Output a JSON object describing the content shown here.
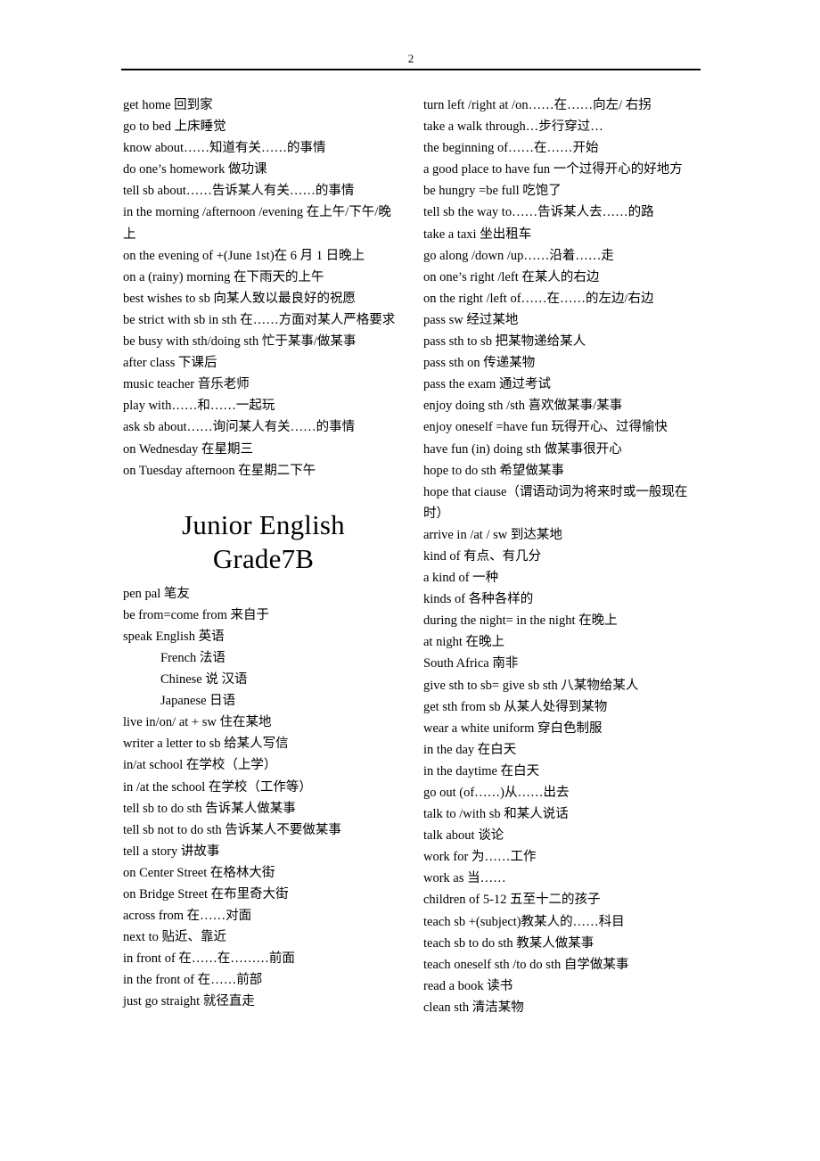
{
  "header": {
    "page_number": "2"
  },
  "title": {
    "line1": "Junior English",
    "line2": "Grade7B"
  },
  "left_column": {
    "entries_before_title": [
      "get home 回到家",
      "go to bed 上床睡觉",
      "know about……知道有关……的事情",
      "do one’s homework 做功课",
      "tell sb about……告诉某人有关……的事情",
      "in the morning /afternoon /evening 在上午/下午/晚上",
      "on the evening of +(June 1st)在 6 月 1 日晚上",
      "on a (rainy) morning 在下雨天的上午",
      "best    wishes to sb 向某人致以最良好的祝愿",
      "be strict with sb in sth 在……方面对某人严格要求",
      "be busy with sth/doing sth 忙于某事/做某事",
      "after class 下课后",
      "music teacher 音乐老师",
      "play with……和……一起玩",
      "ask sb about……询问某人有关……的事情",
      "on Wednesday 在星期三",
      "on Tuesday afternoon 在星期二下午"
    ],
    "entries_after_title": [
      {
        "text": "pen pal 笔友",
        "indent": false
      },
      {
        "text": "be from=come from 来自于",
        "indent": false
      },
      {
        "text": "speak English      英语",
        "indent": false
      },
      {
        "text": "French        法语",
        "indent": true
      },
      {
        "text": "Chinese 说  汉语",
        "indent": true
      },
      {
        "text": "Japanese        日语",
        "indent": true
      },
      {
        "text": "live    in/on/ at + sw 住在某地",
        "indent": false
      },
      {
        "text": "writer a letter to sb 给某人写信",
        "indent": false
      },
      {
        "text": "in/at school 在学校（上学）",
        "indent": false
      },
      {
        "text": "in /at the school 在学校（工作等）",
        "indent": false
      },
      {
        "text": "tell sb to do sth 告诉某人做某事",
        "indent": false
      },
      {
        "text": "tell sb not to do sth 告诉某人不要做某事",
        "indent": false
      },
      {
        "text": "tell a story 讲故事",
        "indent": false
      },
      {
        "text": "on Center Street 在格林大街",
        "indent": false
      },
      {
        "text": "on Bridge Street 在布里奇大街",
        "indent": false
      },
      {
        "text": "across from 在……对面",
        "indent": false
      },
      {
        "text": "next to 贴近、靠近",
        "indent": false
      },
      {
        "text": "in front of 在……在………前面",
        "indent": false
      },
      {
        "text": "in the front of 在……前部",
        "indent": false
      },
      {
        "text": "just go straight 就径直走",
        "indent": false
      }
    ]
  },
  "right_column": {
    "entries": [
      "turn left /right at /on……在……向左/ 右拐",
      "take    a walk through…步行穿过…",
      "the beginning of……在……开始",
      "a good place to have fun 一个过得开心的好地方",
      "be hungry =be full 吃饱了",
      "tell sb the way to……告诉某人去……的路",
      "take    a taxi 坐出租车",
      "go along /down /up……沿着……走",
      "on one’s right /left 在某人的右边",
      "on the right /left of……在……的左边/右边",
      "pass sw 经过某地",
      "pass sth to sb 把某物递给某人",
      "pass sth on 传递某物",
      "pass the exam 通过考试",
      "enjoy doing sth /sth 喜欢做某事/某事",
      "enjoy oneself =have fun 玩得开心、过得愉快",
      "have fun (in) doing sth 做某事很开心",
      "hope to do sth 希望做某事",
      "hope that ciause（谓语动词为将来时或一般现在时）",
      "arrive in /at / sw 到达某地",
      "kind of 有点、有几分",
      "a kind of  一种",
      "kinds of 各种各样的",
      "during the night= in the night 在晚上",
      "at night 在晚上",
      "South Africa 南非",
      "give sth to sb= give sb sth 八某物给某人",
      "get sth from sb 从某人处得到某物",
      "wear a white uniform 穿白色制服",
      "in the day 在白天",
      "in the daytime 在白天",
      "go out (of……)从……出去",
      "talk to /with sb 和某人说话",
      "talk about 谈论",
      "work for 为……工作",
      "work as 当……",
      "children of 5-12 五至十二的孩子",
      "teach sb +(subject)教某人的……科目",
      "teach sb to do sth 教某人做某事",
      "teach oneself sth /to do sth 自学做某事",
      "read a book 读书",
      "clean sth 清洁某物"
    ]
  }
}
